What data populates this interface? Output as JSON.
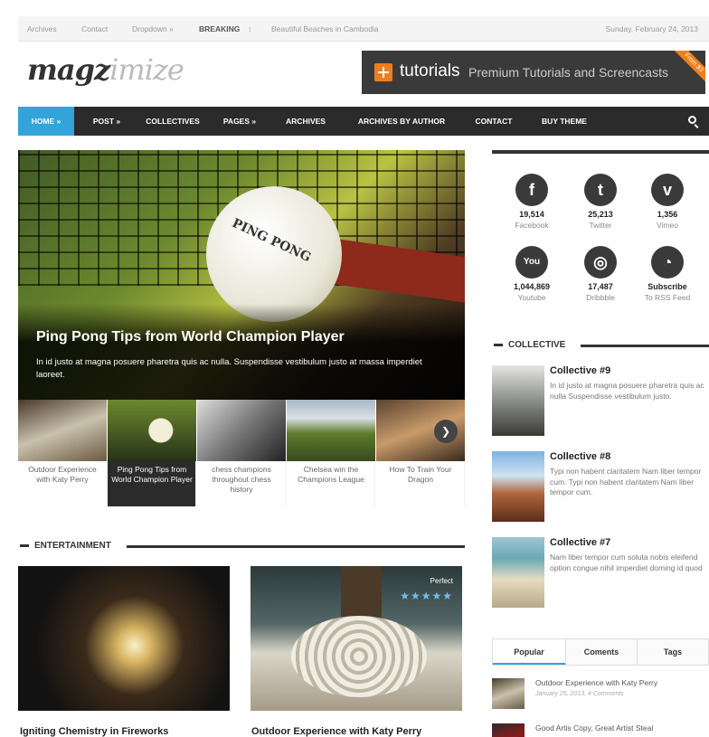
{
  "topbar": {
    "links": [
      "Archives",
      "Contact",
      "Dropdown »"
    ],
    "breaking_label": "BREAKING",
    "breaking_text": "Beautiful Beaches in Cambodia",
    "date": "Sunday, February 24, 2013"
  },
  "logo": {
    "part1": "magz",
    "part2": "imize"
  },
  "banner": {
    "word": "tutorials",
    "tagline": "Premium Tutorials and Screencasts",
    "corner": "From $3"
  },
  "nav": {
    "items": [
      "HOME »",
      "POST »",
      "COLLECTIVES",
      "PAGES »",
      "ARCHIVES",
      "ARCHIVES BY AUTHOR",
      "CONTACT",
      "BUY THEME"
    ],
    "active_index": 0
  },
  "hero": {
    "ball_text": "PING PONG",
    "title": "Ping Pong Tips from World Champion Player",
    "desc": "In id justo at magna posuere pharetra quis ac nulla. Suspendisse vestibulum justo at massa imperdiet laoreet."
  },
  "thumbnails": [
    {
      "caption": "Outdoor Experience with Katy Perry"
    },
    {
      "caption": "Ping Pong Tips from World Champion Player"
    },
    {
      "caption": "chess champions throughout chess history"
    },
    {
      "caption": "Chelsea win the Champions League"
    },
    {
      "caption": "How To Train Your Dragon"
    }
  ],
  "entertainment": {
    "heading": "ENTERTAINMENT",
    "posts": [
      {
        "title": "Igniting Chemistry in Fireworks"
      },
      {
        "title": "Outdoor Experience with Katy Perry",
        "badge": "Perfect",
        "stars": "★★★★★"
      }
    ]
  },
  "social": [
    {
      "icon": "f",
      "count": "19,514",
      "name": "Facebook"
    },
    {
      "icon": "t",
      "count": "25,213",
      "name": "Twitter"
    },
    {
      "icon": "v",
      "count": "1,356",
      "name": "Vimeo"
    },
    {
      "icon": "You",
      "count": "1,044,869",
      "name": "Youtube"
    },
    {
      "icon": "◎",
      "count": "17,487",
      "name": "Dribbble"
    },
    {
      "icon": "◔",
      "count": "Subscribe",
      "name": "To RSS Feed"
    }
  ],
  "collective": {
    "heading": "COLLECTIVE",
    "items": [
      {
        "title": "Collective #9",
        "desc": "In id justo at magna posuere pharetra quis ac nulla Suspendisse vestibulum justo."
      },
      {
        "title": "Collective #8",
        "desc": "Typi non habent claritatem Nam liber tempor cum. Typi non habent claritatem Nam liber tempor cum."
      },
      {
        "title": "Collective #7",
        "desc": "Nam liber tempor cum soluta nobis eleifend option congue nihil imperdiet doming id quod"
      }
    ]
  },
  "tabs": [
    "Popular",
    "Coments",
    "Tags"
  ],
  "popular": [
    {
      "title": "Outdoor Experience with Katy Perry",
      "meta": "January 25, 2013, 4 Comments"
    },
    {
      "title": "Good Artis Copy, Great Artist Steal",
      "meta": ""
    }
  ],
  "colors": {
    "accent": "#33a3d8",
    "nav_bg": "#2b2b2b",
    "banner_orange": "#f07e1e"
  }
}
